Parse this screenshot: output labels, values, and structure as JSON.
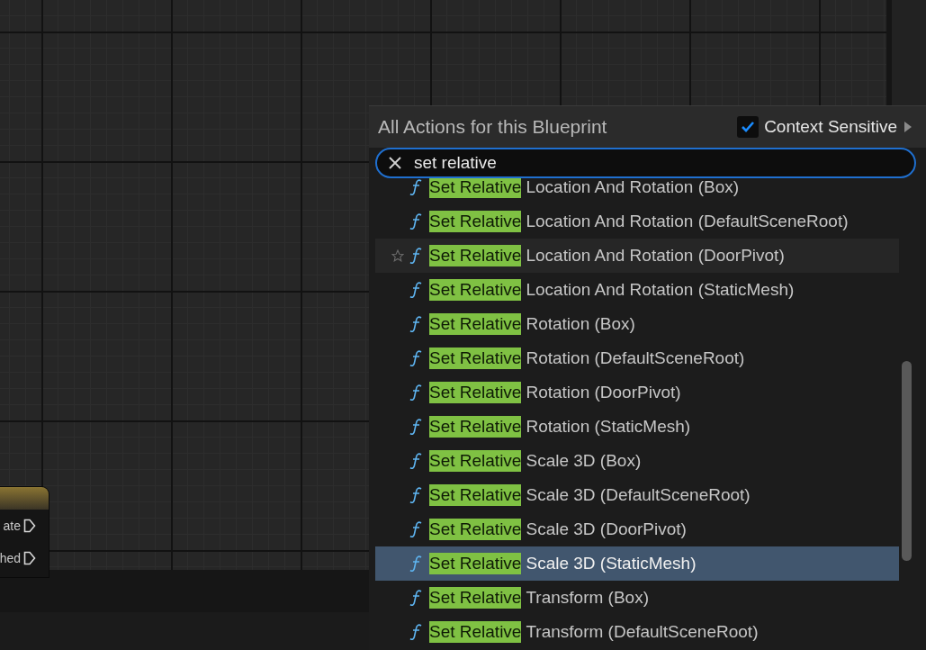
{
  "graph_node": {
    "pins": [
      {
        "label": "ate"
      },
      {
        "label": "hed"
      }
    ]
  },
  "action_menu": {
    "title": "All Actions for this Blueprint",
    "context_sensitive": {
      "label": "Context Sensitive",
      "checked": true
    },
    "search": {
      "value": "set relative"
    },
    "actions": [
      {
        "match": "Set Relative",
        "rest": "Location And Rotation (Box)",
        "hovered": false,
        "selected": false
      },
      {
        "match": "Set Relative",
        "rest": "Location And Rotation (DefaultSceneRoot)",
        "hovered": false,
        "selected": false
      },
      {
        "match": "Set Relative",
        "rest": "Location And Rotation (DoorPivot)",
        "hovered": true,
        "selected": false
      },
      {
        "match": "Set Relative",
        "rest": "Location And Rotation (StaticMesh)",
        "hovered": false,
        "selected": false
      },
      {
        "match": "Set Relative",
        "rest": "Rotation (Box)",
        "hovered": false,
        "selected": false
      },
      {
        "match": "Set Relative",
        "rest": "Rotation (DefaultSceneRoot)",
        "hovered": false,
        "selected": false
      },
      {
        "match": "Set Relative",
        "rest": "Rotation (DoorPivot)",
        "hovered": false,
        "selected": false
      },
      {
        "match": "Set Relative",
        "rest": "Rotation (StaticMesh)",
        "hovered": false,
        "selected": false
      },
      {
        "match": "Set Relative",
        "rest": "Scale 3D (Box)",
        "hovered": false,
        "selected": false
      },
      {
        "match": "Set Relative",
        "rest": "Scale 3D (DefaultSceneRoot)",
        "hovered": false,
        "selected": false
      },
      {
        "match": "Set Relative",
        "rest": "Scale 3D (DoorPivot)",
        "hovered": false,
        "selected": false
      },
      {
        "match": "Set Relative",
        "rest": "Scale 3D (StaticMesh)",
        "hovered": false,
        "selected": true
      },
      {
        "match": "Set Relative",
        "rest": "Transform (Box)",
        "hovered": false,
        "selected": false
      },
      {
        "match": "Set Relative",
        "rest": "Transform (DefaultSceneRoot)",
        "hovered": false,
        "selected": false
      }
    ]
  }
}
